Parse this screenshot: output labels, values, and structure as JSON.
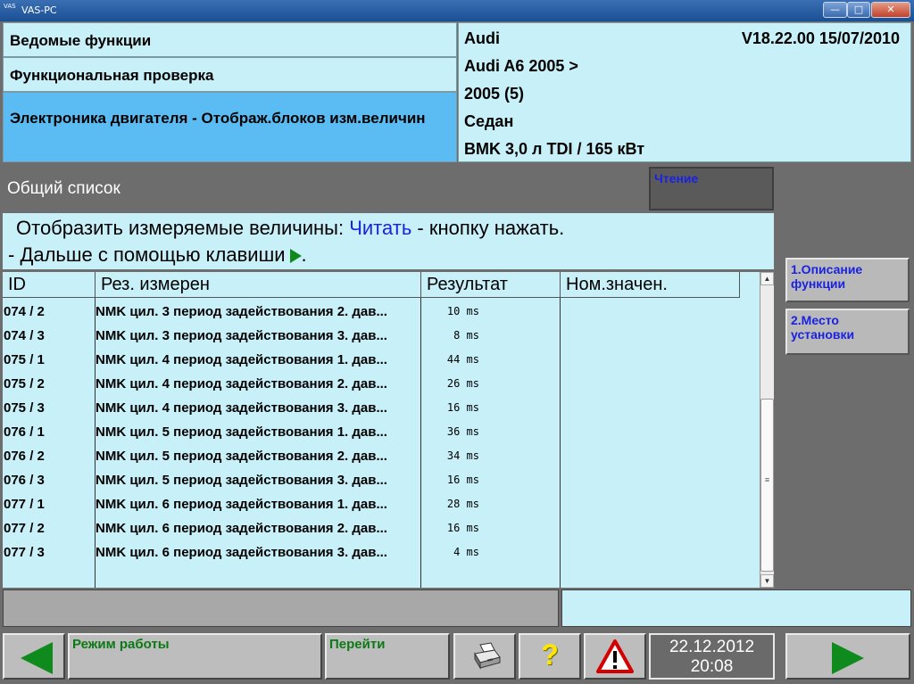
{
  "window": {
    "title": "VAS-PC",
    "app_icon_text": "VAS",
    "btn_min": "—",
    "btn_max": "□",
    "btn_close": "✕"
  },
  "header": {
    "nav1": "Ведомые функции",
    "nav2": "Функциональная проверка",
    "nav3": "Электроника двигателя - Отображ.блоков изм.величин",
    "make": "Audi",
    "version": "V18.22.00 15/07/2010",
    "model": "Audi A6 2005 >",
    "year": "2005 (5)",
    "body": "Седан",
    "engine": "BMK 3,0 л TDI / 165 кВт"
  },
  "main": {
    "section_title": "Общий список",
    "read_status": "Чтение",
    "instruction": {
      "l1_prefix": "Отобразить измеряемые величины:",
      "l1_link": "Читать",
      "l1_suffix": "- кнопку нажать.",
      "l2": "- Дальше с помощью клавиши",
      "l2_end": "."
    }
  },
  "table": {
    "headers": {
      "id": "ID",
      "name": "Рез. измерен",
      "result": "Результат",
      "nominal": "Ном.значен."
    },
    "rows": [
      {
        "id": "074 / 2",
        "name": "NMK цил. 3 период задействования 2. дав...",
        "result": "10 ms"
      },
      {
        "id": "074 / 3",
        "name": "NMK цил. 3 период задействования 3. дав...",
        "result": "8 ms"
      },
      {
        "id": "075 / 1",
        "name": "NMK цил. 4 период задействования 1. дав...",
        "result": "44 ms"
      },
      {
        "id": "075 / 2",
        "name": "NMK цил. 4 период задействования 2. дав...",
        "result": "26 ms"
      },
      {
        "id": "075 / 3",
        "name": "NMK цил. 4 период задействования 3. дав...",
        "result": "16 ms"
      },
      {
        "id": "076 / 1",
        "name": "NMK цил. 5 период задействования 1. дав...",
        "result": "36 ms"
      },
      {
        "id": "076 / 2",
        "name": "NMK цил. 5 период задействования 2. дав...",
        "result": "34 ms"
      },
      {
        "id": "076 / 3",
        "name": "NMK цил. 5 период задействования 3. дав...",
        "result": "16 ms"
      },
      {
        "id": "077 / 1",
        "name": "NMK цил. 6 период задействования 1. дав...",
        "result": "28 ms"
      },
      {
        "id": "077 / 2",
        "name": "NMK цил. 6 период задействования 2. дав...",
        "result": "16 ms"
      },
      {
        "id": "077 / 3",
        "name": "NMK цил. 6 период задействования 3. дав...",
        "result": "4 ms"
      }
    ]
  },
  "side": {
    "btn1": "1.Описание функции",
    "btn2": "2.Место установки"
  },
  "footer": {
    "mode_label": "Режим работы",
    "goto_label": "Перейти",
    "help_label": "?",
    "date": "22.12.2012",
    "time": "20:08"
  },
  "colors": {
    "panel": "#c8f0f9",
    "active_nav": "#5bbcf3",
    "link_blue": "#1a22e0",
    "arrow_green": "#0f8a1c",
    "background": "#6d6d6d"
  }
}
